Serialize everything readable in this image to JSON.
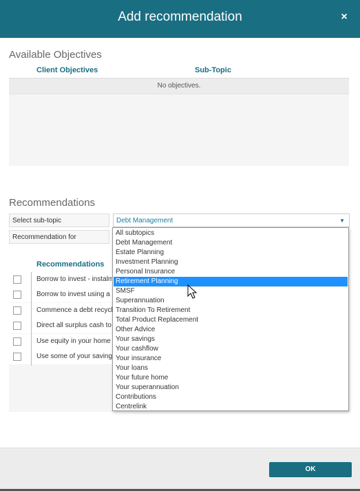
{
  "dialog": {
    "title": "Add recommendation",
    "close_icon": "×"
  },
  "objectives": {
    "title": "Available Objectives",
    "columns": [
      "Client Objectives",
      "Sub-Topic"
    ],
    "empty_text": "No objectives."
  },
  "recommendations": {
    "title": "Recommendations",
    "subtopic_label": "Select sub-topic",
    "subtopic_value": "Debt Management",
    "rec_for_label": "Recommendation for",
    "column_header": "Recommendations",
    "rows": [
      "Borrow to invest - instalm",
      "Borrow to invest using a m",
      "Commence a debt recycli",
      "Direct all surplus cash to",
      "Use equity in your home a",
      "Use some of your savings"
    ]
  },
  "dropdown": {
    "selected_index": 5,
    "options": [
      "All subtopics",
      "Debt Management",
      "Estate Planning",
      "Investment Planning",
      "Personal Insurance",
      "Retirement Planning",
      "SMSF",
      "Superannuation",
      "Transition To Retirement",
      "Total Product Replacement",
      "Other Advice",
      "Your savings",
      "Your cashflow",
      "Your insurance",
      "Your loans",
      "Your future home",
      "Your superannuation",
      "Contributions",
      "Centrelink"
    ]
  },
  "footer": {
    "ok_label": "OK"
  },
  "colors": {
    "header": "#1a6e82",
    "accent": "#1a6e82",
    "selection": "#1e90ff"
  }
}
